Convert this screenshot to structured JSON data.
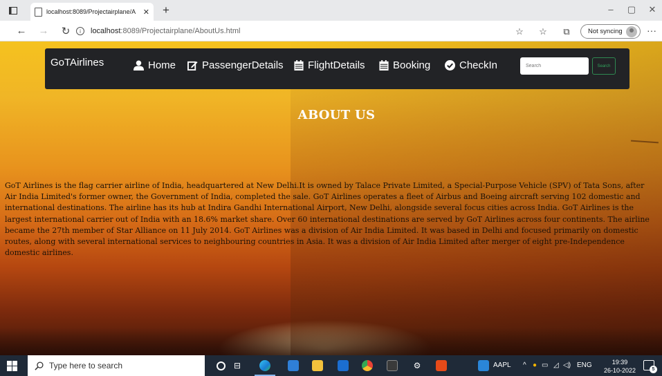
{
  "browser": {
    "tab_title": "localhost:8089/Projectairplane/A",
    "new_tab_icon": "+",
    "url_host": "localhost",
    "url_path": ":8089/Projectairplane/AboutUs.html",
    "sync_label": "Not syncing",
    "minimize": "–",
    "restore": "▢",
    "close": "✕"
  },
  "navbar": {
    "brand": "GoTAirlines",
    "items": [
      {
        "label": "Home",
        "icon": "user-icon"
      },
      {
        "label": "PassengerDetails",
        "icon": "edit-icon"
      },
      {
        "label": "FlightDetails",
        "icon": "calendar-icon"
      },
      {
        "label": "Booking",
        "icon": "calendar-icon"
      },
      {
        "label": "CheckIn",
        "icon": "check-circle-icon"
      }
    ],
    "search_placeholder": "Search",
    "search_button": "Search"
  },
  "main": {
    "heading": "ABOUT US",
    "lines": [
      "GoT Airlines is the flag carrier airline of India, headquartered at New Delhi.It is owned by Talace Private Limited, a Special-Purpose Vehicle (SPV) of Tata Sons, after",
      "Air India Limited's former owner, the Government of India, completed the sale. GoT Airlines operates a fleet of Airbus and Boeing aircraft serving 102 domestic and",
      "international destinations. The airline has its hub at Indira Gandhi International Airport, New Delhi, alongside several focus cities across India. GoT Airlines is the",
      "largest international carrier out of India with an 18.6% market share. Over 60 international destinations are served by GoT Airlines across four continents. The airline",
      "became the 27th member of Star Alliance on 11 July 2014. GoT Airlines was a division of Air India Limited. It was based in Delhi and focused primarily on domestic",
      "routes, along with several international services to neighbouring countries in Asia. It was a division of Air India Limited after merger of eight pre-Independence",
      "domestic airlines."
    ]
  },
  "taskbar": {
    "search_placeholder": "Type here to search",
    "aapl_label": "AAPL",
    "language": "ENG",
    "time": "19:39",
    "date": "26-10-2022",
    "notification_count": "5"
  },
  "colors": {
    "navbar_bg": "#222326",
    "search_button": "#31a35d",
    "taskbar_bg": "#1f2a38",
    "sky_top": "#f5c21f",
    "sky_bottom": "#44180a"
  }
}
